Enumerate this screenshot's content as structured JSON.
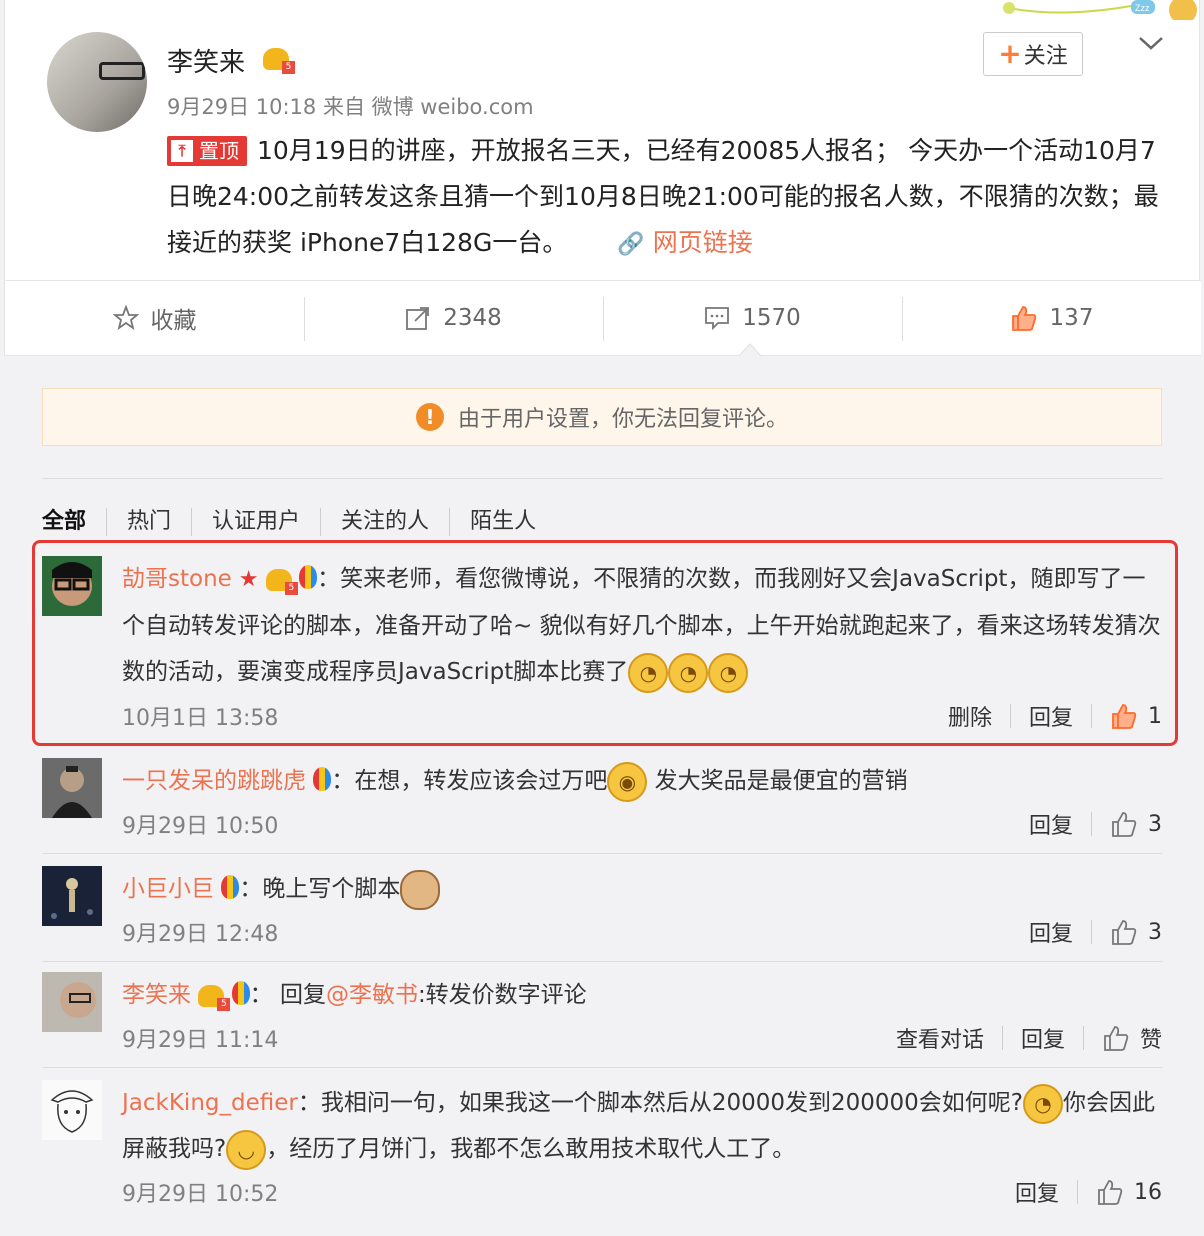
{
  "post": {
    "author": "李笑来",
    "meta": "9月29日 10:18 来自 微博 weibo.com",
    "follow_label": "关注",
    "pin_label": "置顶",
    "text": "10月19日的讲座，开放报名三天，已经有20085人报名； 今天办一个活动10月7日晚24:00之前转发这条且猜一个到10月8日晚21:00可能的报名人数，不限猜的次数；最接近的获奖 iPhone7白128G一台。",
    "link_label": "网页链接"
  },
  "actions": {
    "favorite": "收藏",
    "reposts": "2348",
    "comments": "1570",
    "likes": "137"
  },
  "notice": "由于用户设置，你无法回复评论。",
  "tabs": [
    "全部",
    "热门",
    "认证用户",
    "关注的人",
    "陌生人"
  ],
  "comments": [
    {
      "user": "劼哥stone",
      "text": "笑来老师，看您微博说，不限猜的次数，而我刚好又会JavaScript，随即写了一个自动转发评论的脚本，准备开动了哈~ 貌似有好几个脚本，上午开始就跑起来了，看来这场转发猜次数的活动，要演变成程序员JavaScript脚本比赛了",
      "time": "10月1日 13:58",
      "delete": "删除",
      "reply": "回复",
      "likes": "1"
    },
    {
      "user": "一只发呆的跳跳虎",
      "text_a": "在想，转发应该会过万吧",
      "text_b": "发大奖品是最便宜的营销",
      "time": "9月29日 10:50",
      "reply": "回复",
      "likes": "3"
    },
    {
      "user": "小巨小巨",
      "text": "晚上写个脚本",
      "time": "9月29日 12:48",
      "reply": "回复",
      "likes": "3"
    },
    {
      "user": "李笑来",
      "reply_prefix": "回复",
      "reply_to": "@李敏书",
      "text": ":转发价数字评论",
      "time": "9月29日 11:14",
      "view_convo": "查看对话",
      "reply": "回复",
      "like_label": "赞"
    },
    {
      "user": "JackKing_defier",
      "text_a": "我相问一句，如果我这一个脚本然后从20000发到200000会如何呢?",
      "text_b": "你会因此屏蔽我吗?",
      "text_c": "，经历了月饼门，我都不怎么敢用技术取代人工了。",
      "time": "9月29日 10:52",
      "reply": "回复",
      "likes": "16"
    }
  ],
  "colors": {
    "accent": "#eb7350",
    "highlight": "#e53935",
    "like_active": "#ff6a2b"
  }
}
